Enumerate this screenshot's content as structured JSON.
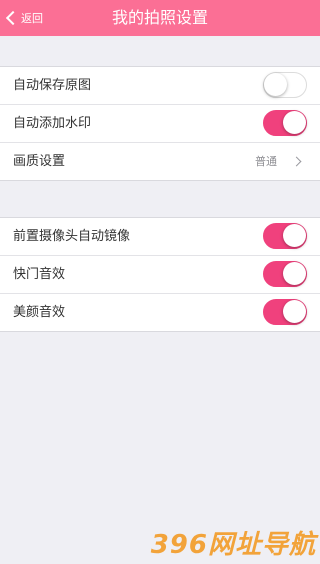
{
  "nav": {
    "back_label": "返回",
    "title": "我的拍照设置",
    "bg_color": "#fb6f95"
  },
  "group1": [
    {
      "label": "自动保存原图",
      "type": "toggle",
      "on": false
    },
    {
      "label": "自动添加水印",
      "type": "toggle",
      "on": true
    },
    {
      "label": "画质设置",
      "type": "select",
      "value": "普通"
    }
  ],
  "group2": [
    {
      "label": "前置摄像头自动镜像",
      "type": "toggle",
      "on": true
    },
    {
      "label": "快门音效",
      "type": "toggle",
      "on": true
    },
    {
      "label": "美颜音效",
      "type": "toggle",
      "on": true
    }
  ],
  "watermark": "396网址导航",
  "colors": {
    "toggle_on": "#f0417d",
    "background": "#efeff4"
  }
}
